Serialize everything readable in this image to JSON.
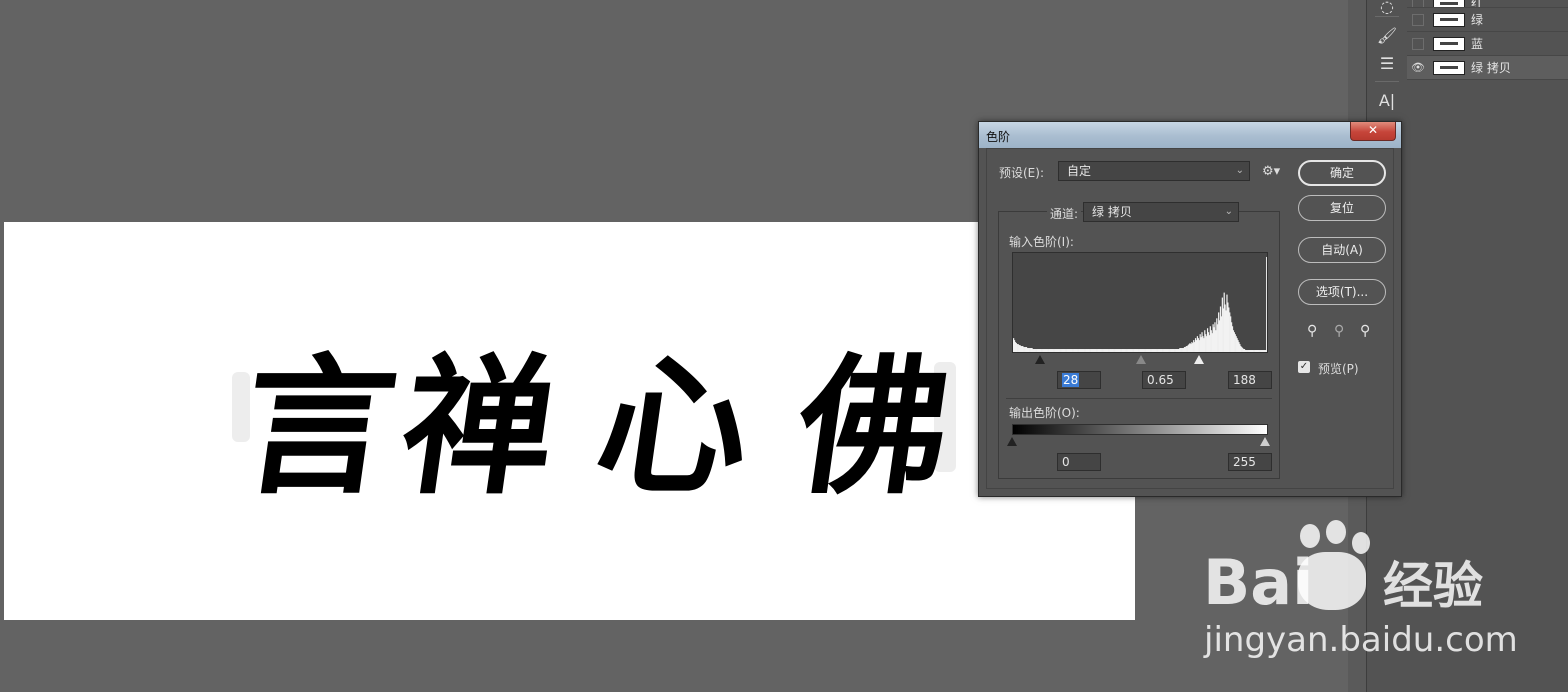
{
  "canvas": {
    "artwork_chars": [
      "言",
      "禅",
      "心",
      "佛"
    ]
  },
  "layers": [
    {
      "name": "红",
      "visible": false,
      "partial": true
    },
    {
      "name": "绿",
      "visible": false
    },
    {
      "name": "蓝",
      "visible": false
    },
    {
      "name": "绿 拷贝",
      "visible": true,
      "active": true
    }
  ],
  "dialog": {
    "title": "色阶",
    "close_label": "✕",
    "preset_label": "预设(E):",
    "preset_value": "自定",
    "channel_label": "通道:",
    "channel_value": "绿 拷贝",
    "input_levels_label": "输入色阶(I):",
    "input_black": "28",
    "input_gamma": "0.65",
    "input_white": "188",
    "output_levels_label": "输出色阶(O):",
    "output_black": "0",
    "output_white": "255",
    "buttons": {
      "ok": "确定",
      "reset": "复位",
      "auto": "自动(A)",
      "options": "选项(T)..."
    },
    "preview_label": "预览(P)",
    "preview_checked": true
  },
  "histogram": {
    "bins": [
      14,
      12,
      10,
      9,
      8,
      8,
      7,
      7,
      6,
      6,
      6,
      5,
      5,
      5,
      5,
      4,
      4,
      4,
      4,
      4,
      4,
      3,
      3,
      3,
      3,
      3,
      3,
      3,
      3,
      3,
      3,
      3,
      3,
      3,
      3,
      3,
      3,
      3,
      3,
      3,
      3,
      3,
      3,
      3,
      3,
      3,
      3,
      3,
      3,
      3,
      3,
      3,
      3,
      3,
      3,
      3,
      3,
      3,
      3,
      3,
      3,
      3,
      3,
      3,
      3,
      3,
      3,
      3,
      3,
      3,
      3,
      3,
      3,
      3,
      3,
      3,
      3,
      3,
      3,
      3,
      3,
      3,
      3,
      3,
      3,
      3,
      3,
      3,
      3,
      3,
      3,
      3,
      3,
      3,
      3,
      3,
      3,
      3,
      3,
      3,
      3,
      3,
      3,
      3,
      3,
      3,
      3,
      3,
      3,
      3,
      3,
      3,
      3,
      3,
      3,
      3,
      3,
      3,
      3,
      3,
      3,
      3,
      3,
      3,
      3,
      3,
      3,
      3,
      3,
      3,
      3,
      3,
      3,
      3,
      3,
      3,
      3,
      3,
      3,
      3,
      3,
      3,
      3,
      3,
      3,
      3,
      3,
      3,
      3,
      3,
      3,
      3,
      3,
      3,
      3,
      3,
      3,
      3,
      3,
      3,
      3,
      3,
      3,
      3,
      3,
      3,
      3,
      3,
      3,
      3,
      3,
      3,
      3,
      3,
      3,
      3,
      3,
      3,
      3,
      3,
      4,
      4,
      4,
      4,
      4,
      5,
      5,
      6,
      6,
      7,
      8,
      9,
      8,
      10,
      9,
      12,
      10,
      14,
      12,
      16,
      14,
      12,
      18,
      15,
      20,
      16,
      14,
      22,
      18,
      16,
      24,
      20,
      17,
      26,
      22,
      19,
      28,
      25,
      30,
      22,
      34,
      28,
      40,
      32,
      46,
      36,
      55,
      44,
      60,
      48,
      42,
      58,
      50,
      45,
      40,
      36,
      30,
      26,
      22,
      20,
      18,
      16,
      14,
      12,
      10,
      8,
      6,
      5,
      4,
      3,
      3,
      2,
      2,
      2,
      2,
      2,
      2,
      2,
      2,
      2,
      2,
      2,
      2,
      2,
      2,
      2,
      2,
      2,
      2,
      2,
      2,
      2,
      2,
      2,
      96
    ]
  },
  "watermark": {
    "brand_left": "Bai",
    "brand_right": "经验",
    "url": "jingyan.baidu.com"
  }
}
